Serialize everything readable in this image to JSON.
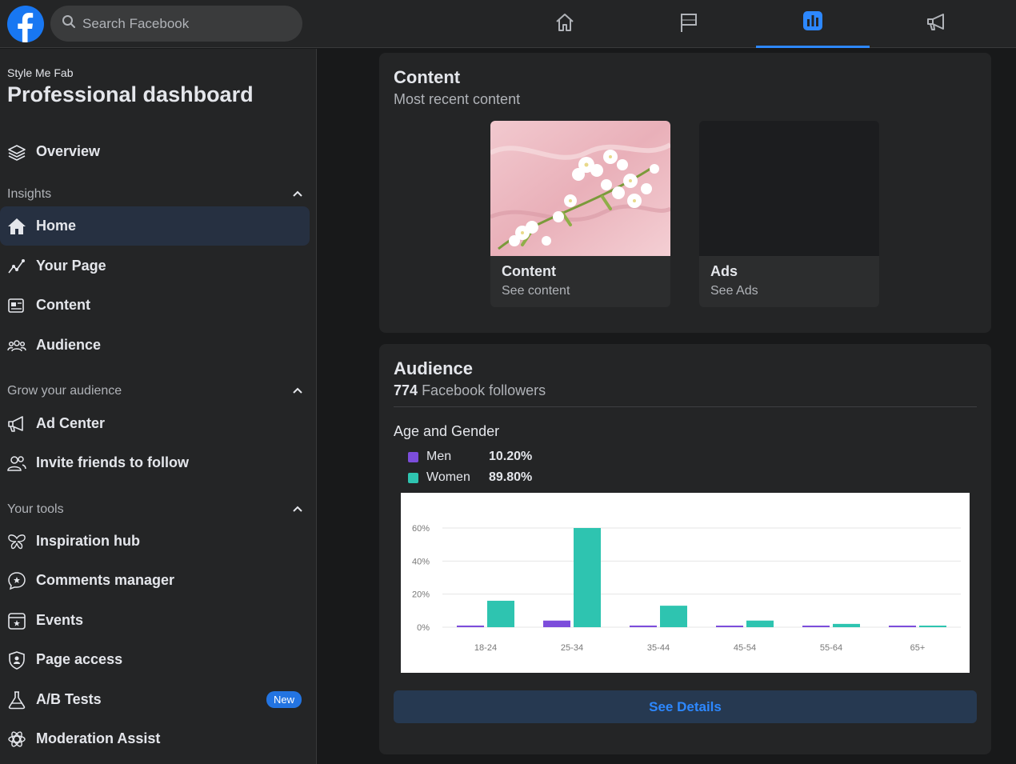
{
  "search": {
    "placeholder": "Search Facebook"
  },
  "nav": {
    "tabs": [
      {
        "name": "home-icon"
      },
      {
        "name": "flag-icon"
      },
      {
        "name": "insights-icon",
        "active": true
      },
      {
        "name": "megaphone-icon"
      }
    ]
  },
  "sidebar": {
    "page_name": "Style Me Fab",
    "title": "Professional dashboard",
    "overview": "Overview",
    "sections": {
      "insights": "Insights",
      "grow": "Grow your audience",
      "tools": "Your tools"
    },
    "insights_items": [
      "Home",
      "Your Page",
      "Content",
      "Audience"
    ],
    "grow_items": [
      "Ad Center",
      "Invite friends to follow"
    ],
    "tools_items": [
      "Inspiration hub",
      "Comments manager",
      "Events",
      "Page access",
      "A/B Tests",
      "Moderation Assist"
    ],
    "new_badge": "New"
  },
  "content_card": {
    "title": "Content",
    "subtitle": "Most recent content",
    "tiles": [
      {
        "title": "Content",
        "sub": "See content"
      },
      {
        "title": "Ads",
        "sub": "See Ads"
      }
    ]
  },
  "audience_card": {
    "title": "Audience",
    "followers_count": "774",
    "followers_label": "Facebook followers",
    "section_title": "Age and Gender",
    "legend": [
      {
        "name": "Men",
        "pct": "10.20%",
        "color": "#7c4ddb"
      },
      {
        "name": "Women",
        "pct": "89.80%",
        "color": "#2ec4b0"
      }
    ],
    "see_details": "See Details"
  },
  "chart_data": {
    "type": "bar",
    "categories": [
      "18-24",
      "25-34",
      "35-44",
      "45-54",
      "55-64",
      "65+"
    ],
    "series": [
      {
        "name": "Men",
        "values": [
          1,
          4,
          1,
          0.5,
          0.3,
          0.3
        ],
        "color": "#7c4ddb"
      },
      {
        "name": "Women",
        "values": [
          16,
          60,
          13,
          4,
          2,
          0.6
        ],
        "color": "#2ec4b0"
      }
    ],
    "yticks": [
      "0%",
      "20%",
      "40%",
      "60%"
    ],
    "ylim": [
      0,
      60
    ],
    "grid": true
  }
}
